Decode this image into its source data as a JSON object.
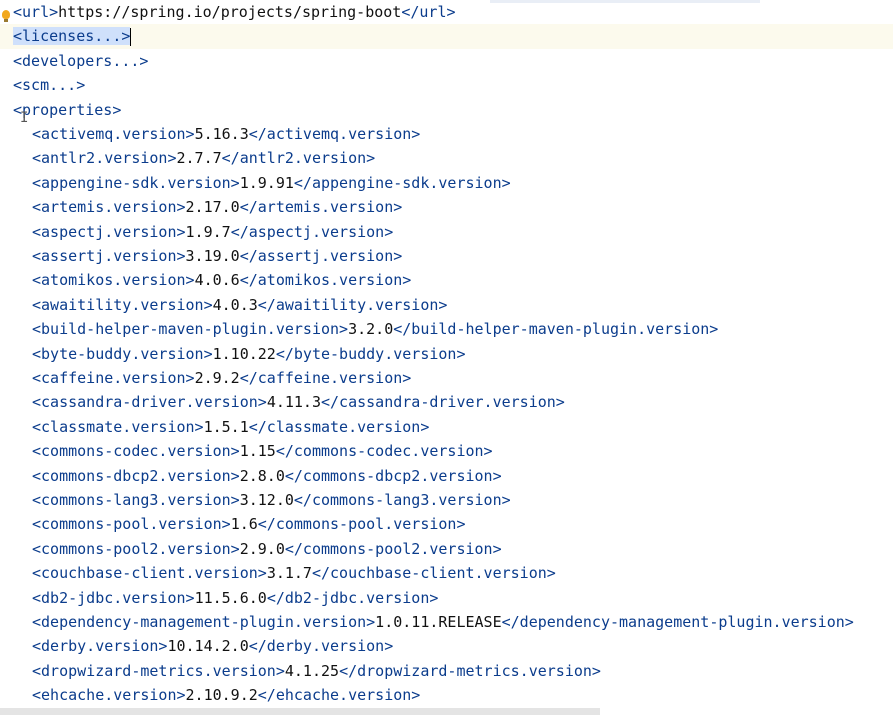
{
  "editor": {
    "header_lines": [
      {
        "open": "<url>",
        "text": "https://spring.io/projects/spring-boot",
        "close": "</url>"
      },
      {
        "collapsed": "<licenses...>",
        "selected": true
      },
      {
        "collapsed": "<developers...>"
      },
      {
        "collapsed": "<scm...>"
      },
      {
        "open": "<properties>"
      }
    ],
    "properties": [
      {
        "name": "activemq.version",
        "value": "5.16.3"
      },
      {
        "name": "antlr2.version",
        "value": "2.7.7"
      },
      {
        "name": "appengine-sdk.version",
        "value": "1.9.91"
      },
      {
        "name": "artemis.version",
        "value": "2.17.0"
      },
      {
        "name": "aspectj.version",
        "value": "1.9.7"
      },
      {
        "name": "assertj.version",
        "value": "3.19.0"
      },
      {
        "name": "atomikos.version",
        "value": "4.0.6"
      },
      {
        "name": "awaitility.version",
        "value": "4.0.3"
      },
      {
        "name": "build-helper-maven-plugin.version",
        "value": "3.2.0"
      },
      {
        "name": "byte-buddy.version",
        "value": "1.10.22"
      },
      {
        "name": "caffeine.version",
        "value": "2.9.2"
      },
      {
        "name": "cassandra-driver.version",
        "value": "4.11.3"
      },
      {
        "name": "classmate.version",
        "value": "1.5.1"
      },
      {
        "name": "commons-codec.version",
        "value": "1.15"
      },
      {
        "name": "commons-dbcp2.version",
        "value": "2.8.0"
      },
      {
        "name": "commons-lang3.version",
        "value": "3.12.0"
      },
      {
        "name": "commons-pool.version",
        "value": "1.6"
      },
      {
        "name": "commons-pool2.version",
        "value": "2.9.0"
      },
      {
        "name": "couchbase-client.version",
        "value": "3.1.7"
      },
      {
        "name": "db2-jdbc.version",
        "value": "11.5.6.0"
      },
      {
        "name": "dependency-management-plugin.version",
        "value": "1.0.11.RELEASE"
      },
      {
        "name": "derby.version",
        "value": "10.14.2.0"
      },
      {
        "name": "dropwizard-metrics.version",
        "value": "4.1.25"
      },
      {
        "name": "ehcache.version",
        "value": "2.10.9.2"
      }
    ]
  }
}
